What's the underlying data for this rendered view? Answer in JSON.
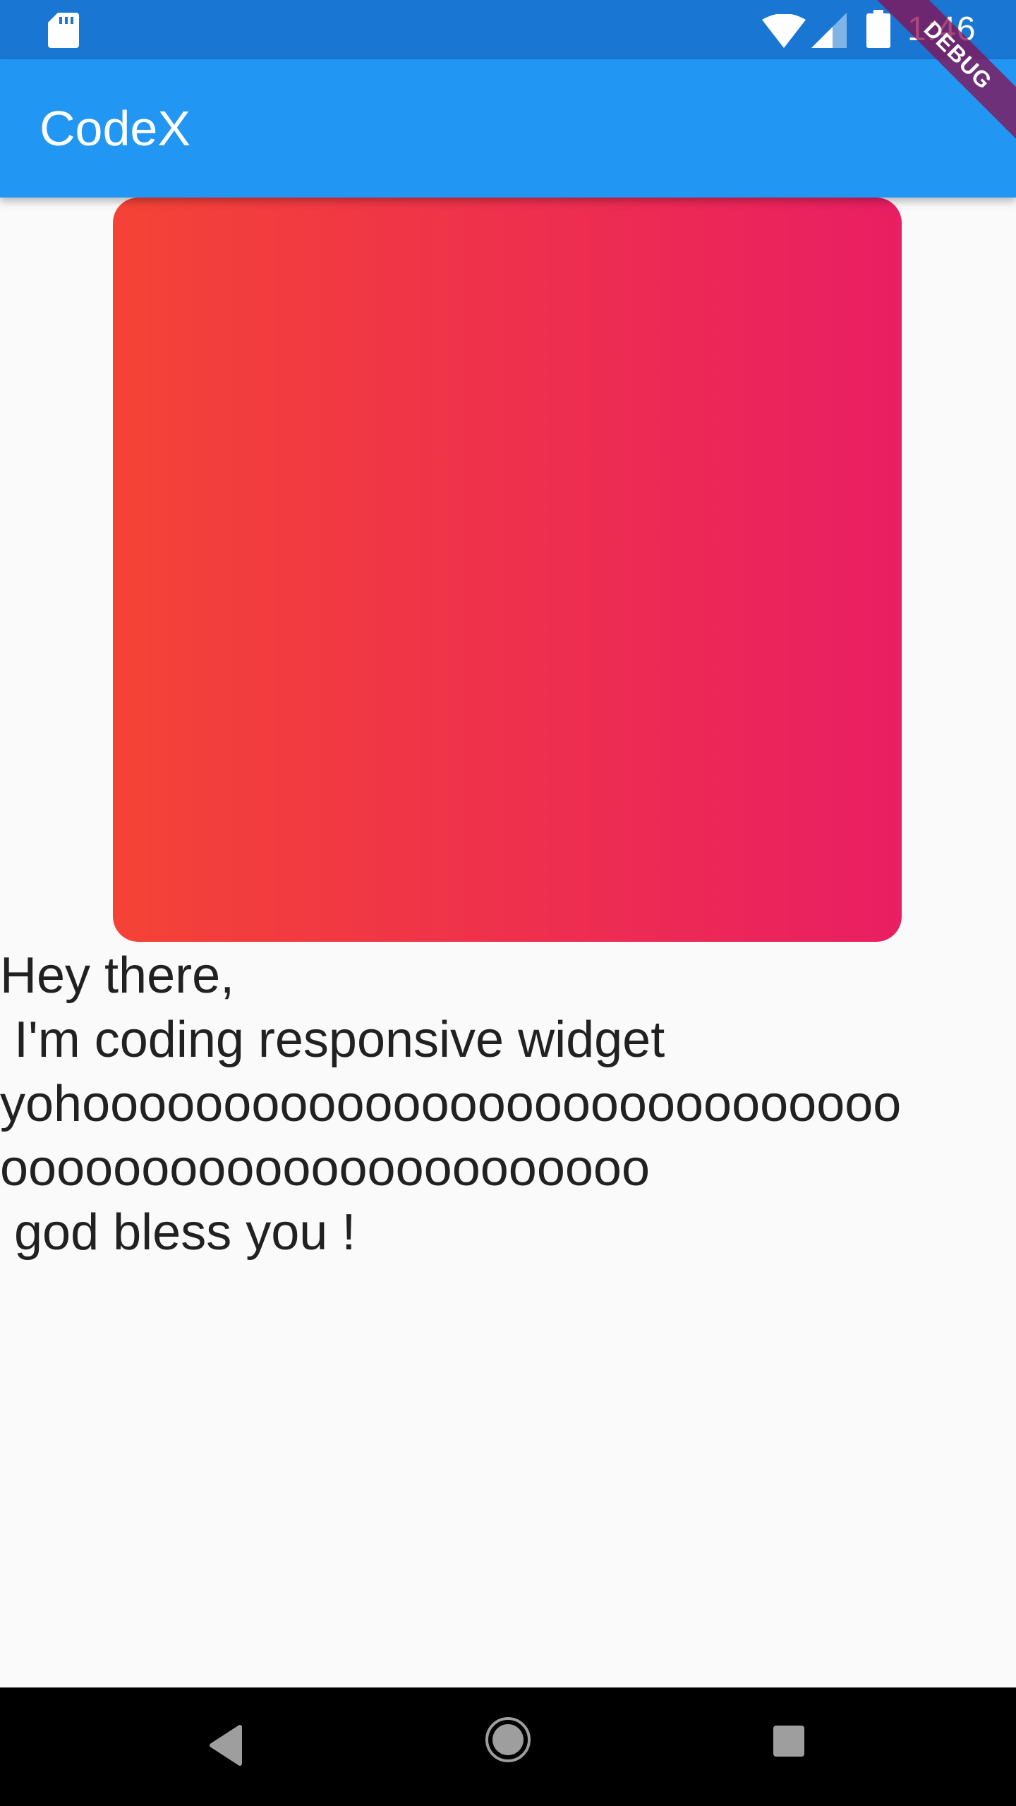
{
  "status_bar": {
    "time": "1:46",
    "icons": [
      "sd-card-icon",
      "wifi-icon",
      "signal-icon",
      "battery-icon"
    ],
    "background_color": "#1976d2"
  },
  "app_bar": {
    "title": "CodeX",
    "background_color": "#2196f3"
  },
  "debug_banner": {
    "label": "DEBUG"
  },
  "content": {
    "gradient_box": {
      "color_start": "#f44336",
      "color_end": "#e91e63"
    },
    "message": "Hey there,\n I'm coding responsive widget\nyohooooooooooooooooooooooooooooo\nooooooooooooooooooooooo\n god bless you !"
  },
  "nav_bar": {
    "icons": [
      "back-icon",
      "home-icon",
      "recent-apps-icon"
    ]
  }
}
